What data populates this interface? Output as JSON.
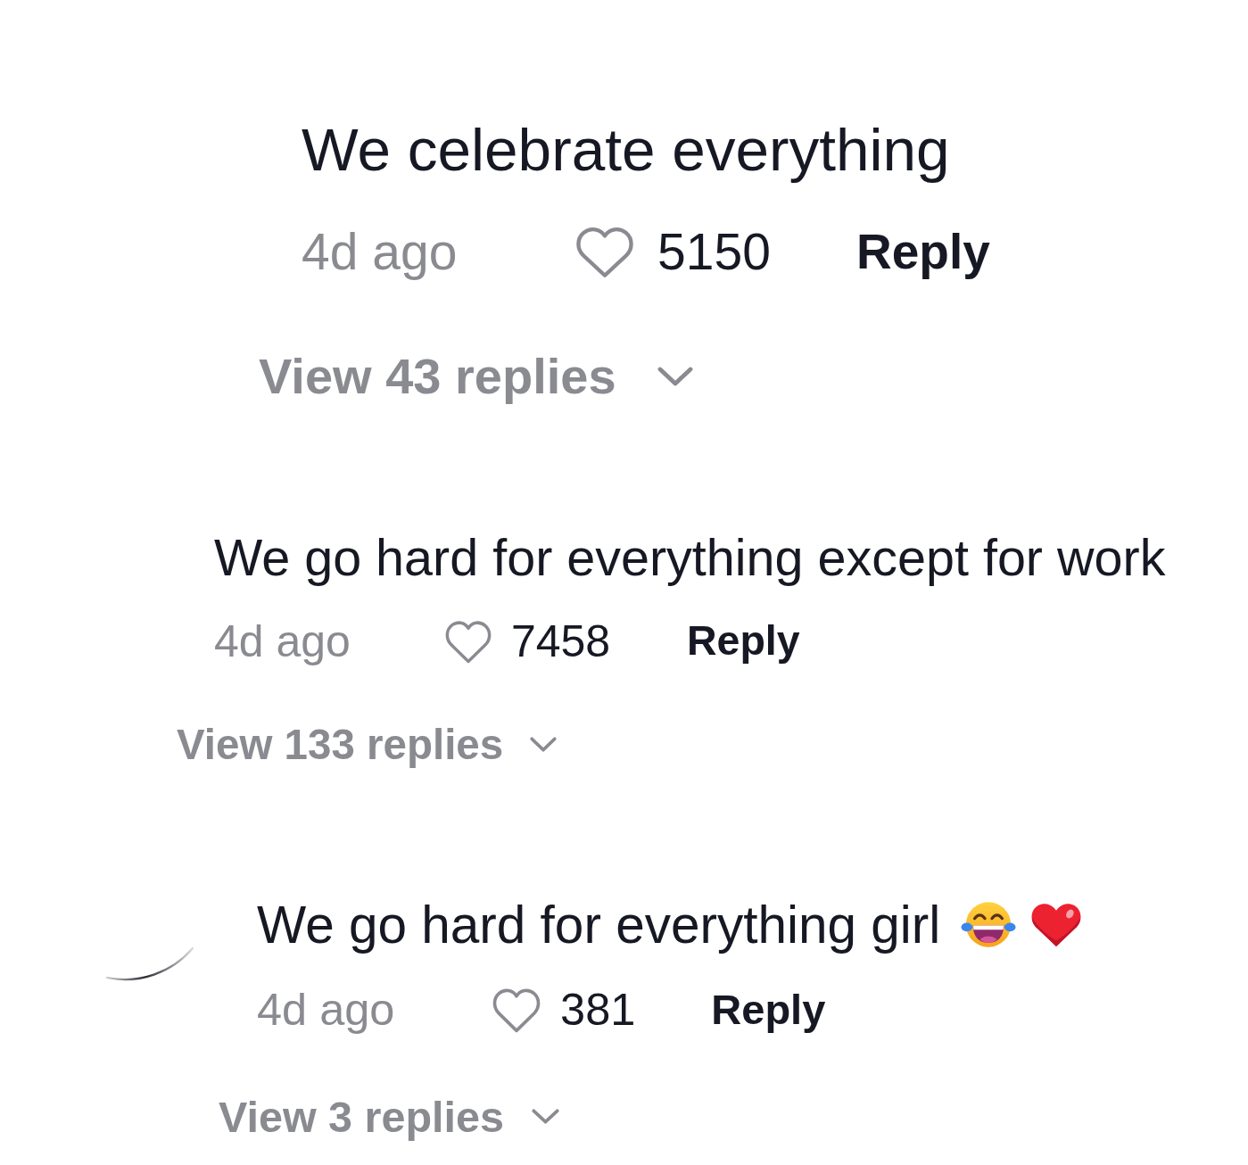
{
  "comments": [
    {
      "text": "We celebrate everything",
      "time": "4d ago",
      "liked": false,
      "likes": "5150",
      "reply": "Reply",
      "view_replies": "View 43 replies"
    },
    {
      "text": "We go hard for everything except for work",
      "time": "4d ago",
      "liked": false,
      "likes": "7458",
      "reply": "Reply",
      "view_replies": "View 133 replies"
    },
    {
      "avatar_edge": true,
      "text": "We go hard for everything girl",
      "emojis": [
        {
          "kind": "laughing"
        },
        {
          "kind": "heart"
        }
      ],
      "time": "4d ago",
      "liked": false,
      "likes": "381",
      "reply": "Reply",
      "view_replies": "View 3 replies"
    }
  ]
}
